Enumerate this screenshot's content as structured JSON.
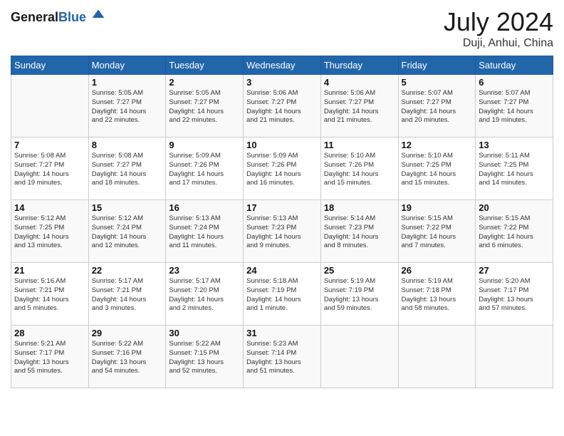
{
  "header": {
    "logo_general": "General",
    "logo_blue": "Blue",
    "month_year": "July 2024",
    "location": "Duji, Anhui, China"
  },
  "weekdays": [
    "Sunday",
    "Monday",
    "Tuesday",
    "Wednesday",
    "Thursday",
    "Friday",
    "Saturday"
  ],
  "weeks": [
    [
      {
        "day": "",
        "info": ""
      },
      {
        "day": "1",
        "info": "Sunrise: 5:05 AM\nSunset: 7:27 PM\nDaylight: 14 hours\nand 22 minutes."
      },
      {
        "day": "2",
        "info": "Sunrise: 5:05 AM\nSunset: 7:27 PM\nDaylight: 14 hours\nand 22 minutes."
      },
      {
        "day": "3",
        "info": "Sunrise: 5:06 AM\nSunset: 7:27 PM\nDaylight: 14 hours\nand 21 minutes."
      },
      {
        "day": "4",
        "info": "Sunrise: 5:06 AM\nSunset: 7:27 PM\nDaylight: 14 hours\nand 21 minutes."
      },
      {
        "day": "5",
        "info": "Sunrise: 5:07 AM\nSunset: 7:27 PM\nDaylight: 14 hours\nand 20 minutes."
      },
      {
        "day": "6",
        "info": "Sunrise: 5:07 AM\nSunset: 7:27 PM\nDaylight: 14 hours\nand 19 minutes."
      }
    ],
    [
      {
        "day": "7",
        "info": "Sunrise: 5:08 AM\nSunset: 7:27 PM\nDaylight: 14 hours\nand 19 minutes."
      },
      {
        "day": "8",
        "info": "Sunrise: 5:08 AM\nSunset: 7:27 PM\nDaylight: 14 hours\nand 18 minutes."
      },
      {
        "day": "9",
        "info": "Sunrise: 5:09 AM\nSunset: 7:26 PM\nDaylight: 14 hours\nand 17 minutes."
      },
      {
        "day": "10",
        "info": "Sunrise: 5:09 AM\nSunset: 7:26 PM\nDaylight: 14 hours\nand 16 minutes."
      },
      {
        "day": "11",
        "info": "Sunrise: 5:10 AM\nSunset: 7:26 PM\nDaylight: 14 hours\nand 15 minutes."
      },
      {
        "day": "12",
        "info": "Sunrise: 5:10 AM\nSunset: 7:25 PM\nDaylight: 14 hours\nand 15 minutes."
      },
      {
        "day": "13",
        "info": "Sunrise: 5:11 AM\nSunset: 7:25 PM\nDaylight: 14 hours\nand 14 minutes."
      }
    ],
    [
      {
        "day": "14",
        "info": "Sunrise: 5:12 AM\nSunset: 7:25 PM\nDaylight: 14 hours\nand 13 minutes."
      },
      {
        "day": "15",
        "info": "Sunrise: 5:12 AM\nSunset: 7:24 PM\nDaylight: 14 hours\nand 12 minutes."
      },
      {
        "day": "16",
        "info": "Sunrise: 5:13 AM\nSunset: 7:24 PM\nDaylight: 14 hours\nand 11 minutes."
      },
      {
        "day": "17",
        "info": "Sunrise: 5:13 AM\nSunset: 7:23 PM\nDaylight: 14 hours\nand 9 minutes."
      },
      {
        "day": "18",
        "info": "Sunrise: 5:14 AM\nSunset: 7:23 PM\nDaylight: 14 hours\nand 8 minutes."
      },
      {
        "day": "19",
        "info": "Sunrise: 5:15 AM\nSunset: 7:22 PM\nDaylight: 14 hours\nand 7 minutes."
      },
      {
        "day": "20",
        "info": "Sunrise: 5:15 AM\nSunset: 7:22 PM\nDaylight: 14 hours\nand 6 minutes."
      }
    ],
    [
      {
        "day": "21",
        "info": "Sunrise: 5:16 AM\nSunset: 7:21 PM\nDaylight: 14 hours\nand 5 minutes."
      },
      {
        "day": "22",
        "info": "Sunrise: 5:17 AM\nSunset: 7:21 PM\nDaylight: 14 hours\nand 3 minutes."
      },
      {
        "day": "23",
        "info": "Sunrise: 5:17 AM\nSunset: 7:20 PM\nDaylight: 14 hours\nand 2 minutes."
      },
      {
        "day": "24",
        "info": "Sunrise: 5:18 AM\nSunset: 7:19 PM\nDaylight: 14 hours\nand 1 minute."
      },
      {
        "day": "25",
        "info": "Sunrise: 5:19 AM\nSunset: 7:19 PM\nDaylight: 13 hours\nand 59 minutes."
      },
      {
        "day": "26",
        "info": "Sunrise: 5:19 AM\nSunset: 7:18 PM\nDaylight: 13 hours\nand 58 minutes."
      },
      {
        "day": "27",
        "info": "Sunrise: 5:20 AM\nSunset: 7:17 PM\nDaylight: 13 hours\nand 57 minutes."
      }
    ],
    [
      {
        "day": "28",
        "info": "Sunrise: 5:21 AM\nSunset: 7:17 PM\nDaylight: 13 hours\nand 55 minutes."
      },
      {
        "day": "29",
        "info": "Sunrise: 5:22 AM\nSunset: 7:16 PM\nDaylight: 13 hours\nand 54 minutes."
      },
      {
        "day": "30",
        "info": "Sunrise: 5:22 AM\nSunset: 7:15 PM\nDaylight: 13 hours\nand 52 minutes."
      },
      {
        "day": "31",
        "info": "Sunrise: 5:23 AM\nSunset: 7:14 PM\nDaylight: 13 hours\nand 51 minutes."
      },
      {
        "day": "",
        "info": ""
      },
      {
        "day": "",
        "info": ""
      },
      {
        "day": "",
        "info": ""
      }
    ]
  ]
}
